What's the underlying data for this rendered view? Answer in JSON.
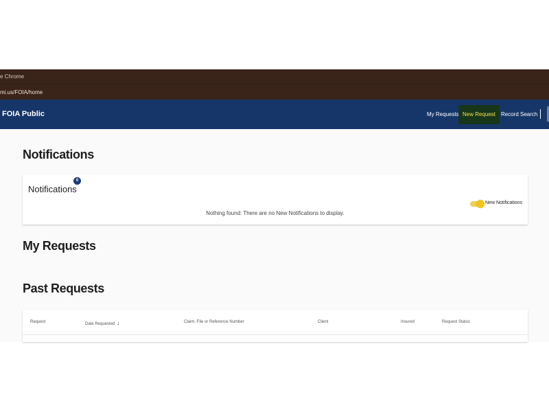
{
  "browser": {
    "title_fragment": "e Chrome",
    "url_fragment": "mi.us/FOIA/home"
  },
  "appbar": {
    "brand": "FOIA Public",
    "nav": [
      {
        "label": "My Requests"
      },
      {
        "label": "New Request"
      },
      {
        "label": "Record Search"
      }
    ]
  },
  "main": {
    "notifications_heading": "Notifications",
    "notifications_card": {
      "title": "Notifications",
      "badge_count": "0",
      "toggle_label": "New Notifications",
      "empty_message": "Nothing found: There are no New Notifications to display."
    },
    "my_requests_heading": "My Requests",
    "past_requests_heading": "Past Requests",
    "table": {
      "columns": [
        {
          "label": "Request"
        },
        {
          "label": "Date Requested"
        },
        {
          "label": "Claim, File or Reference Number"
        },
        {
          "label": "Client"
        },
        {
          "label": "Insured"
        },
        {
          "label": "Request Status"
        }
      ]
    }
  },
  "colors": {
    "appbar_bg": "#163669",
    "active_nav_bg": "#17361a",
    "active_nav_text": "#f3e04a",
    "toggle": "#f2c31a",
    "badge": "#1c3b78"
  }
}
